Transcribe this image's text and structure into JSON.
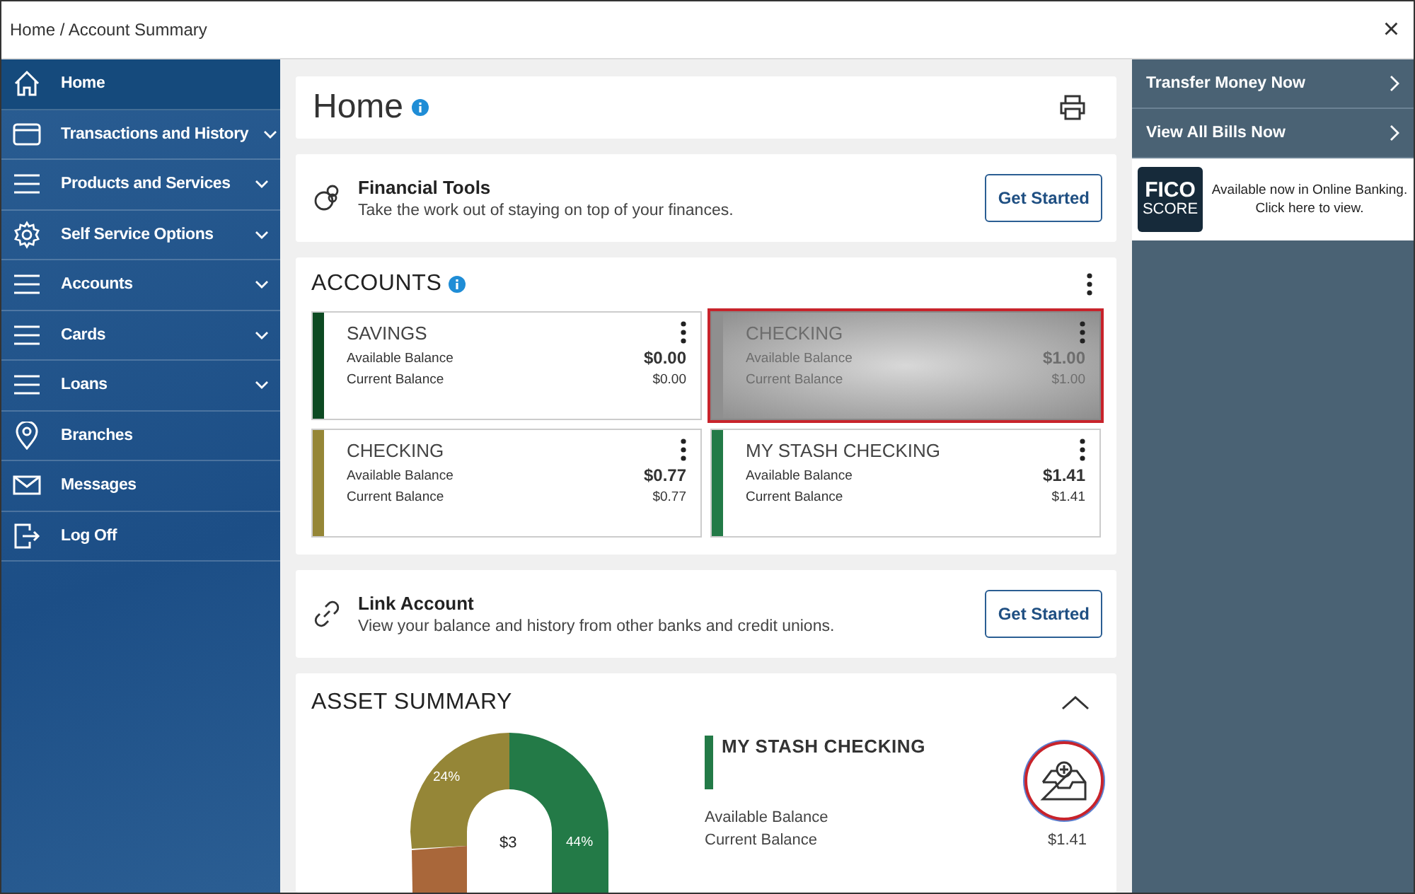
{
  "breadcrumb": "Home / Account Summary",
  "close": "×",
  "sidebar": {
    "items": [
      {
        "label": "Home",
        "kind": "home",
        "selected": true,
        "expandable": false
      },
      {
        "label": "Transactions and History",
        "kind": "card",
        "selected": false,
        "expandable": true
      },
      {
        "label": "Products and Services",
        "kind": "menu",
        "selected": false,
        "expandable": true
      },
      {
        "label": "Self Service Options",
        "kind": "gear",
        "selected": false,
        "expandable": true
      },
      {
        "label": "Accounts",
        "kind": "menu",
        "selected": false,
        "expandable": true
      },
      {
        "label": "Cards",
        "kind": "menu",
        "selected": false,
        "expandable": true
      },
      {
        "label": "Loans",
        "kind": "menu",
        "selected": false,
        "expandable": true
      },
      {
        "label": "Branches",
        "kind": "pin",
        "selected": false,
        "expandable": false
      },
      {
        "label": "Messages",
        "kind": "mail",
        "selected": false,
        "expandable": false
      },
      {
        "label": "Log Off",
        "kind": "logoff",
        "selected": false,
        "expandable": false
      }
    ]
  },
  "page_title": "Home",
  "financial_tools": {
    "title": "Financial Tools",
    "description": "Take the work out of staying on top of your finances.",
    "button": "Get Started"
  },
  "accounts": {
    "title": "ACCOUNTS",
    "cards": [
      {
        "name": "SAVINGS",
        "color": "#0d4a22",
        "highlighted": false,
        "available_label": "Available Balance",
        "available": "$0.00",
        "current_label": "Current Balance",
        "current": "$0.00"
      },
      {
        "name": "CHECKING",
        "color": "#8f8f8f",
        "highlighted": true,
        "available_label": "Available Balance",
        "available": "$1.00",
        "current_label": "Current Balance",
        "current": "$1.00"
      },
      {
        "name": "CHECKING",
        "color": "#958637",
        "highlighted": false,
        "available_label": "Available Balance",
        "available": "$0.77",
        "current_label": "Current Balance",
        "current": "$0.77"
      },
      {
        "name": "MY STASH CHECKING",
        "color": "#237a47",
        "highlighted": false,
        "available_label": "Available Balance",
        "available": "$1.41",
        "current_label": "Current Balance",
        "current": "$1.41"
      }
    ]
  },
  "link_account": {
    "title": "Link Account",
    "description": "View your balance and history from other banks and credit unions.",
    "button": "Get Started"
  },
  "asset_summary": {
    "title": "ASSET SUMMARY",
    "expanded": true,
    "donut_center": "$3",
    "slice_labels": [
      "44%",
      "24%"
    ],
    "detail": {
      "name": "MY STASH CHECKING",
      "color": "#237a47",
      "available_label": "Available Balance",
      "current_label": "Current Balance",
      "current": "$1.41"
    }
  },
  "right_panel": {
    "links": [
      "Transfer Money Now",
      "View All Bills Now"
    ],
    "fico_logo_top": "FICO",
    "fico_logo_bottom": "SCORE",
    "fico_text": "Available now in Online Banking. Click here to view."
  }
}
